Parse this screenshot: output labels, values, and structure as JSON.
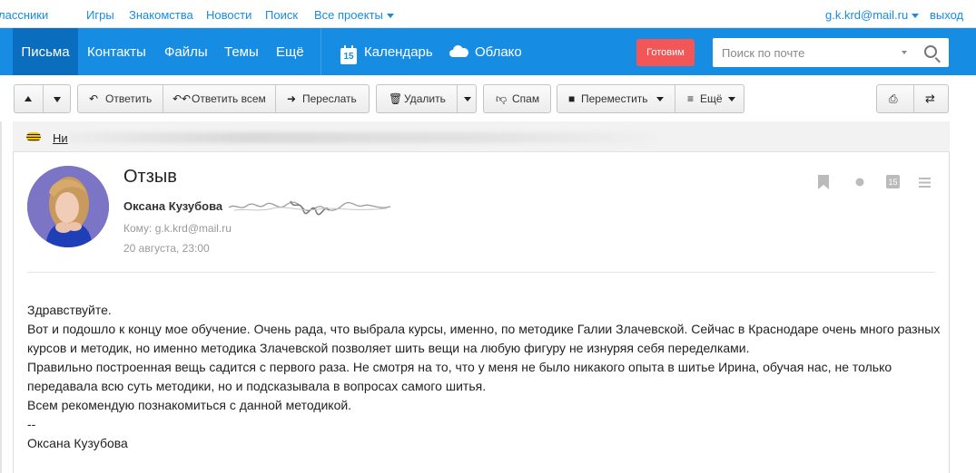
{
  "portal": {
    "items": [
      "лассники",
      "Игры",
      "Знакомства",
      "Новости",
      "Поиск",
      "Все проекты"
    ],
    "user_email": "g.k.krd@mail.ru",
    "logout": "выход"
  },
  "nav": {
    "items": [
      "Письма",
      "Контакты",
      "Файлы",
      "Темы",
      "Ещё"
    ],
    "calendar": "Календарь",
    "calendar_day": "15",
    "cloud": "Облако",
    "ready_button": "Готовим",
    "search_placeholder": "Поиск по почте"
  },
  "toolbar": {
    "reply": "Ответить",
    "reply_all": "Ответить всем",
    "forward": "Переслать",
    "delete": "Удалить",
    "spam": "Спам",
    "move": "Переместить",
    "more": "Ещё"
  },
  "strip": {
    "link_text": "Ни"
  },
  "letter": {
    "subject": "Отзыв",
    "sender_name": "Оксана Кузубова",
    "to_label": "Кому:",
    "to_value": "g.k.krd@mail.ru",
    "date": "20 августа, 23:00",
    "calendar_icon_day": "15",
    "body": [
      "Здравствуйте.",
      "Вот и подошло к концу мое обучение. Очень рада, что выбрала курсы, именно, по методике Галии Злачевской. Сейчас в Краснодаре очень много разных курсов и методик, но именно методика Злачевской позволяет шить вещи на любую фигуру не изнуряя себя переделками.",
      "Правильно построенная вещь садится с первого раза. Не смотря на то, что у меня не было никакого опыта в шитье Ирина, обучая нас, не только передавала всю суть методики, но и подсказывала в вопросах самого шитья.",
      "Всем рекомендую познакомиться с данной методикой.",
      "--",
      "Оксана Кузубова"
    ]
  },
  "colors": {
    "brand_blue": "#168de2",
    "active_tab": "#0a6dbd",
    "ready_red": "#f25656"
  }
}
